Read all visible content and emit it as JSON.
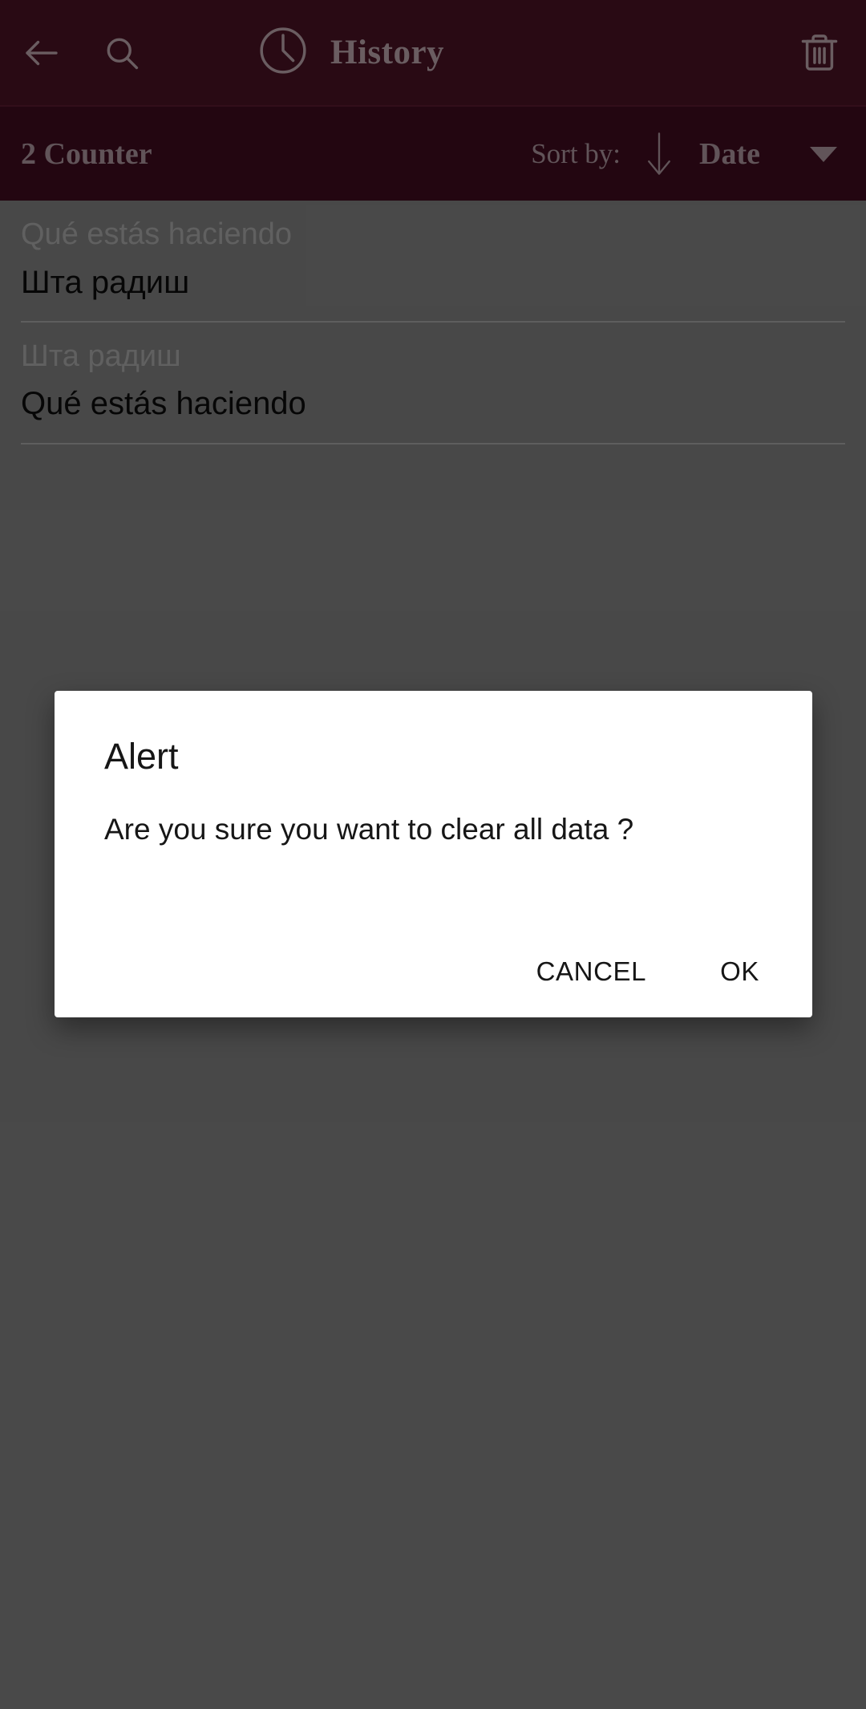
{
  "theme": {
    "appbar_bg": "#3d0f1e",
    "sortbar_bg": "#34091a",
    "appbar_fg": "#9c8a8f",
    "scrim_bg": "#6b6b6b",
    "dialog_bg": "#ffffff",
    "dialog_fg": "#161616",
    "list_sub_fg": "#8e8e8e",
    "list_main_fg": "#0a0a0a",
    "divider": "#8b8b8b"
  },
  "appbar": {
    "title": "History",
    "back_icon": "arrow-left-icon",
    "search_icon": "search-icon",
    "clock_icon": "clock-icon",
    "delete_icon": "trash-icon"
  },
  "sortbar": {
    "counter_label": "2 Counter",
    "sort_by_label": "Sort by:",
    "sort_direction_icon": "arrow-down-icon",
    "sort_field": "Date",
    "caret_icon": "chevron-down-icon",
    "sort_options": [
      "Date"
    ]
  },
  "list": {
    "items": [
      {
        "sub": "Qué estás haciendo",
        "main": "Шта радиш"
      },
      {
        "sub": "Шта радиш",
        "main": "Qué estás haciendo"
      }
    ]
  },
  "dialog": {
    "title": "Alert",
    "message": "Are you sure you want to clear all data ?",
    "cancel_label": "CANCEL",
    "ok_label": "OK"
  }
}
